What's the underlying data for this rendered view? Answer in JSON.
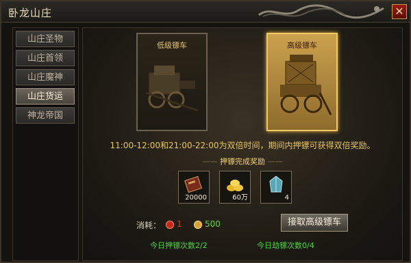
{
  "window": {
    "title": "卧龙山庄",
    "close_glyph": "✕"
  },
  "sidebar": {
    "items": [
      {
        "label": "山庄圣物",
        "active": false
      },
      {
        "label": "山庄首领",
        "active": false
      },
      {
        "label": "山庄魔神",
        "active": false
      },
      {
        "label": "山庄货运",
        "active": true
      },
      {
        "label": "神龙帝国",
        "active": false
      }
    ]
  },
  "carts": [
    {
      "label": "低级镖车",
      "selected": false
    },
    {
      "label": "高级镖车",
      "selected": true
    }
  ],
  "info_text": "11:00-12:00和21:00-22:00为双倍时间，期间内押镖可获得双倍奖励。",
  "reward_title": "押镖完成奖励",
  "rewards": [
    {
      "icon": "book-icon",
      "count": "20000"
    },
    {
      "icon": "gold-coins-icon",
      "count": "60万"
    },
    {
      "icon": "crystal-icon",
      "count": "4"
    }
  ],
  "cost": {
    "label": "消耗：",
    "items": [
      {
        "icon": "red-token-icon",
        "value": "1",
        "color": "#e03a2a"
      },
      {
        "icon": "gold-icon",
        "value": "500",
        "color": "#6bd04a"
      }
    ]
  },
  "action_button": "接取高级镖车",
  "daily": {
    "escort": "今日押镖次数2/2",
    "rob": "今日劫镖次数0/4"
  },
  "colors": {
    "accent_gold": "#f2c860",
    "green_text": "#4fd33f",
    "info_text": "#e8c75c"
  }
}
